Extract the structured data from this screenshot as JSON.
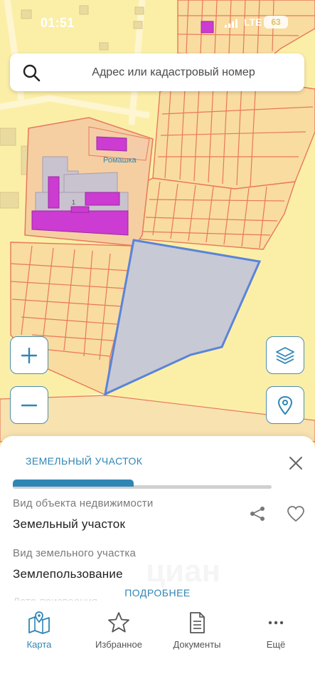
{
  "status_bar": {
    "time": "01:51",
    "network": "LTE",
    "battery": "63"
  },
  "map": {
    "place_label": "Ромашка",
    "building_number": "1",
    "colors": {
      "background": "#fbefa8",
      "parcel_fill": "#f8d9a2",
      "parcel_border": "#e8785a",
      "building": "#cc3bd2",
      "selected_fill": "#c7c9d4",
      "selected_border": "#5a84d8",
      "accent": "#2e86b5"
    }
  },
  "search": {
    "placeholder": "Адрес или кадастровый номер"
  },
  "controls": {
    "zoom_in": "+",
    "zoom_out": "−"
  },
  "sheet": {
    "tab_label": "ЗЕМЕЛЬНЫЙ УЧАСТОК",
    "fields": [
      {
        "label": "Вид объекта недвижимости",
        "value": "Земельный участок"
      },
      {
        "label": "Вид земельного участка",
        "value": "Землепользование"
      }
    ],
    "faded_label": "Дата присвоения",
    "more_link": "ПОДРОБНЕЕ",
    "watermark": "циан"
  },
  "nav": {
    "items": [
      {
        "label": "Карта",
        "icon": "map-icon",
        "active": true
      },
      {
        "label": "Избранное",
        "icon": "star-icon",
        "active": false
      },
      {
        "label": "Документы",
        "icon": "document-icon",
        "active": false
      },
      {
        "label": "Ещё",
        "icon": "more-icon",
        "active": false
      }
    ]
  }
}
